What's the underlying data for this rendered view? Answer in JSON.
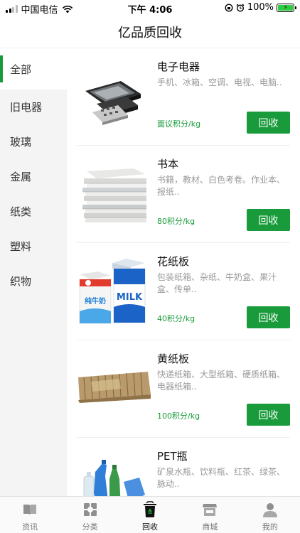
{
  "status_bar": {
    "carrier": "中国电信",
    "time": "下午 4:06",
    "battery": "100%"
  },
  "header": {
    "title": "亿品质回收"
  },
  "sidebar": {
    "items": [
      {
        "label": "全部",
        "active": true
      },
      {
        "label": "旧电器",
        "active": false
      },
      {
        "label": "玻璃",
        "active": false
      },
      {
        "label": "金属",
        "active": false
      },
      {
        "label": "纸类",
        "active": false
      },
      {
        "label": "塑料",
        "active": false
      },
      {
        "label": "织物",
        "active": false
      }
    ]
  },
  "products": [
    {
      "title": "电子电器",
      "desc": "手机、冰箱、空调、电视、电脑..",
      "price": "面议积分/kg",
      "button": "回收",
      "image": "electronics-photo"
    },
    {
      "title": "书本",
      "desc": "书籍，教材、白色考卷。作业本、报纸..",
      "price": "80积分/kg",
      "button": "回收",
      "image": "books-photo"
    },
    {
      "title": "花纸板",
      "desc": "包装纸箱、杂纸、牛奶盒、果汁盒、传单..",
      "price": "40积分/kg",
      "button": "回收",
      "image": "milk-carton-photo",
      "image_text": {
        "carton1": "纯牛奶",
        "carton2": "MILK"
      }
    },
    {
      "title": "黄纸板",
      "desc": "快递纸箱、大型纸箱、硬质纸箱、电器纸箱..",
      "price": "100积分/kg",
      "button": "回收",
      "image": "cardboard-photo"
    },
    {
      "title": "PET瓶",
      "desc": "矿泉水瓶、饮料瓶、红茶、绿茶、脉动..",
      "price": "",
      "button": "",
      "image": "pet-bottles-photo"
    }
  ],
  "tabbar": {
    "items": [
      {
        "label": "资讯",
        "icon": "news-icon",
        "active": false
      },
      {
        "label": "分类",
        "icon": "category-icon",
        "active": false
      },
      {
        "label": "回收",
        "icon": "recycle-bin-icon",
        "active": true
      },
      {
        "label": "商城",
        "icon": "store-icon",
        "active": false
      },
      {
        "label": "我的",
        "icon": "profile-icon",
        "active": false
      }
    ]
  },
  "colors": {
    "accent": "#1a9b3b",
    "sidebar_bg": "#f4f4f4",
    "desc_text": "#999999"
  }
}
